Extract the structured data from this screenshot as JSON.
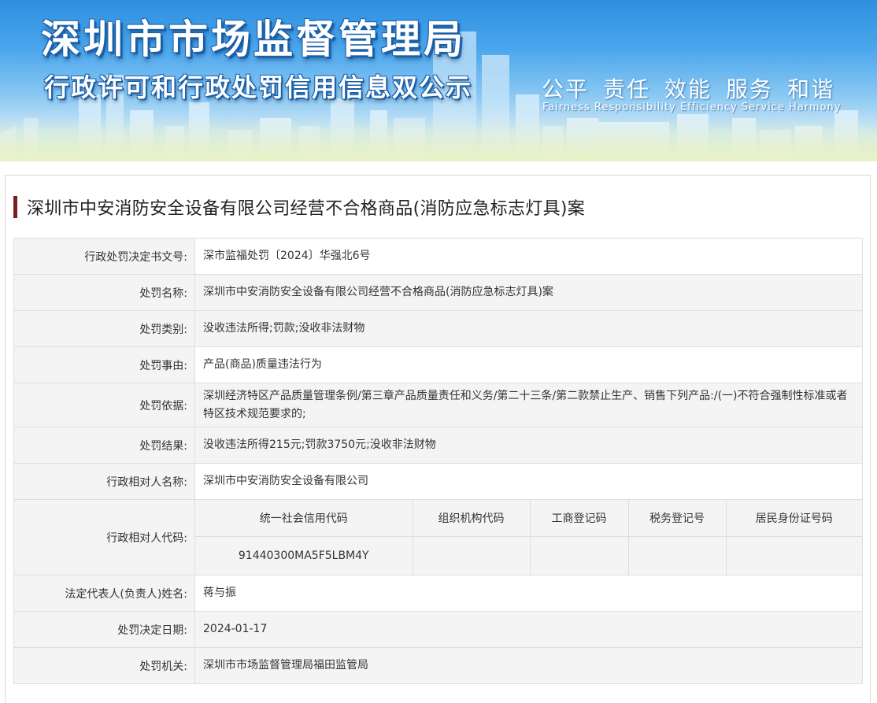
{
  "banner": {
    "title": "深圳市市场监督管理局",
    "subtitle": "行政许可和行政处罚信用信息双公示",
    "slogan_cn": [
      "公平",
      "责任",
      "效能",
      "服务",
      "和谐"
    ],
    "slogan_en": "Fairness  Responsibility  Efficiency  Service  Harmony"
  },
  "case": {
    "title": "深圳市中安消防安全设备有限公司经营不合格商品(消防应急标志灯具)案",
    "accent_color": "#7a1f1f"
  },
  "rows": {
    "doc_no": {
      "label": "行政处罚决定书文号:",
      "value": "深市监福处罚〔2024〕华强北6号"
    },
    "name": {
      "label": "处罚名称:",
      "value": "深圳市中安消防安全设备有限公司经营不合格商品(消防应急标志灯具)案"
    },
    "category": {
      "label": "处罚类别:",
      "value": "没收违法所得;罚款;没收非法财物"
    },
    "reason": {
      "label": "处罚事由:",
      "value": "产品(商品)质量违法行为"
    },
    "basis": {
      "label": "处罚依据:",
      "value": "深圳经济特区产品质量管理条例/第三章产品质量责任和义务/第二十三条/第二款禁止生产、销售下列产品:/(一)不符合强制性标准或者特区技术规范要求的;"
    },
    "result": {
      "label": "处罚结果:",
      "value": "没收违法所得215元;罚款3750元;没收非法财物"
    },
    "party_name": {
      "label": "行政相对人名称:",
      "value": "深圳市中安消防安全设备有限公司"
    },
    "party_code": {
      "label": "行政相对人代码:",
      "headers": [
        "统一社会信用代码",
        "组织机构代码",
        "工商登记码",
        "税务登记号",
        "居民身份证号码"
      ],
      "values": [
        "91440300MA5F5LBM4Y",
        "",
        "",
        "",
        ""
      ]
    },
    "legal_rep": {
      "label": "法定代表人(负责人)姓名:",
      "value": "蒋与振"
    },
    "date": {
      "label": "处罚决定日期:",
      "value": "2024-01-17"
    },
    "authority": {
      "label": "处罚机关:",
      "value": "深圳市市场监督管理局福田监管局"
    }
  }
}
